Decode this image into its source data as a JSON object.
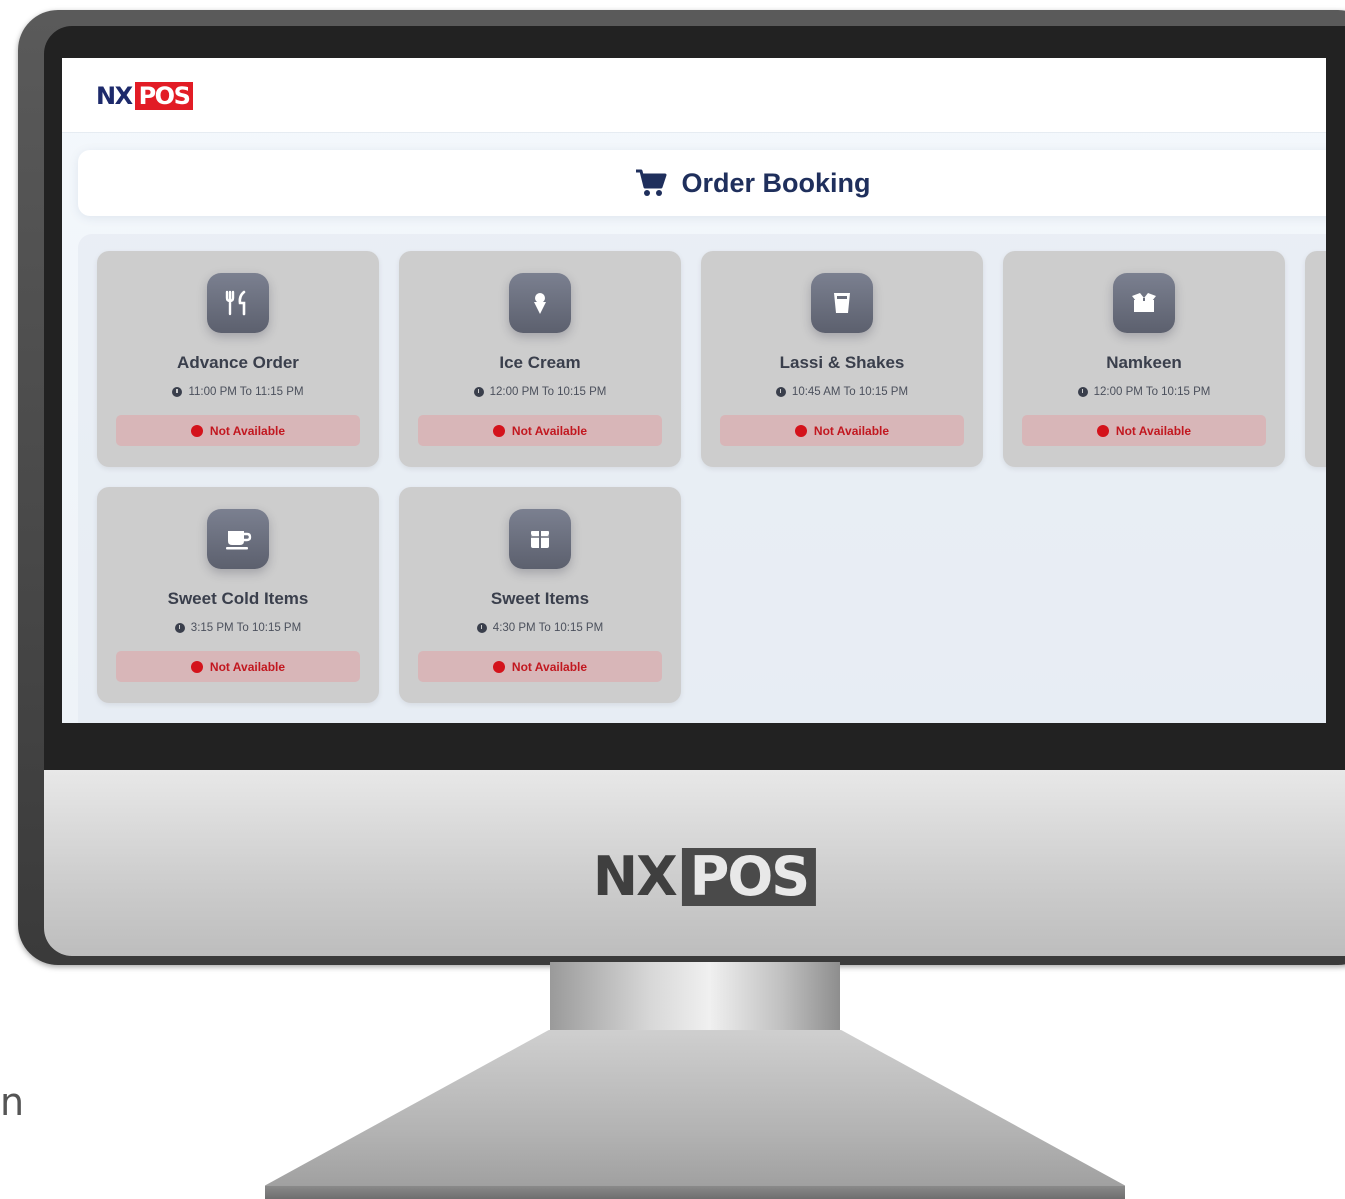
{
  "brand": {
    "nx": "NX",
    "pos": "POS"
  },
  "page": {
    "title": "Order Booking"
  },
  "cards": [
    {
      "name": "Advance Order",
      "time": "11:00 PM To 11:15 PM",
      "status": "Not Available",
      "icon": "utensils-icon",
      "glyph": "🍴"
    },
    {
      "name": "Ice Cream",
      "time": "12:00 PM To 10:15 PM",
      "status": "Not Available",
      "icon": "ice-cream-icon",
      "glyph": "▼"
    },
    {
      "name": "Lassi & Shakes",
      "time": "10:45 AM To 10:15 PM",
      "status": "Not Available",
      "icon": "glass-icon",
      "glyph": "▮"
    },
    {
      "name": "Namkeen",
      "time": "12:00 PM To 10:15 PM",
      "status": "Not Available",
      "icon": "box-open-icon",
      "glyph": "⌗"
    },
    {
      "name": "Sweet Cold Items",
      "time": "3:15 PM To 10:15 PM",
      "status": "Not Available",
      "icon": "mug-icon",
      "glyph": "☕"
    },
    {
      "name": "Sweet Items",
      "time": "4:30 PM To 10:15 PM",
      "status": "Not Available",
      "icon": "gift-box-icon",
      "glyph": "▣"
    }
  ],
  "colors": {
    "accent": "#1f2f5c",
    "danger": "#d4121b",
    "brand_red": "#e21c25"
  }
}
